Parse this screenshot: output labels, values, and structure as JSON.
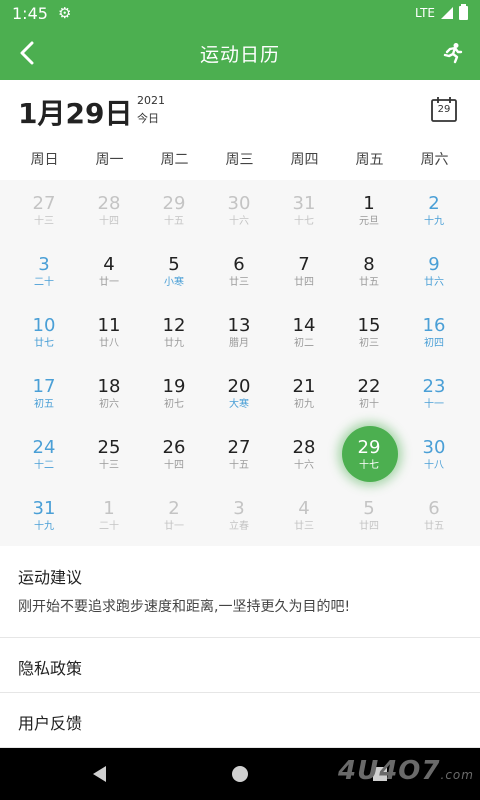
{
  "status_bar": {
    "time": "1:45",
    "network": "LTE"
  },
  "app_bar": {
    "title": "运动日历"
  },
  "date_header": {
    "date": "1月29日",
    "year": "2021",
    "today": "今日",
    "calendar_button_day": "29"
  },
  "weekdays": [
    "周日",
    "周一",
    "周二",
    "周三",
    "周四",
    "周五",
    "周六"
  ],
  "calendar": [
    [
      {
        "d": "27",
        "l": "十三",
        "t": "other"
      },
      {
        "d": "28",
        "l": "十四",
        "t": "other"
      },
      {
        "d": "29",
        "l": "十五",
        "t": "other"
      },
      {
        "d": "30",
        "l": "十六",
        "t": "other"
      },
      {
        "d": "31",
        "l": "十七",
        "t": "other"
      },
      {
        "d": "1",
        "l": "元旦",
        "t": "normal"
      },
      {
        "d": "2",
        "l": "十九",
        "t": "weekend"
      }
    ],
    [
      {
        "d": "3",
        "l": "二十",
        "t": "weekend"
      },
      {
        "d": "4",
        "l": "廿一",
        "t": "normal"
      },
      {
        "d": "5",
        "l": "小寒",
        "t": "normal",
        "term": true
      },
      {
        "d": "6",
        "l": "廿三",
        "t": "normal"
      },
      {
        "d": "7",
        "l": "廿四",
        "t": "normal"
      },
      {
        "d": "8",
        "l": "廿五",
        "t": "normal"
      },
      {
        "d": "9",
        "l": "廿六",
        "t": "weekend"
      }
    ],
    [
      {
        "d": "10",
        "l": "廿七",
        "t": "weekend"
      },
      {
        "d": "11",
        "l": "廿八",
        "t": "normal"
      },
      {
        "d": "12",
        "l": "廿九",
        "t": "normal"
      },
      {
        "d": "13",
        "l": "腊月",
        "t": "normal"
      },
      {
        "d": "14",
        "l": "初二",
        "t": "normal"
      },
      {
        "d": "15",
        "l": "初三",
        "t": "normal"
      },
      {
        "d": "16",
        "l": "初四",
        "t": "weekend"
      }
    ],
    [
      {
        "d": "17",
        "l": "初五",
        "t": "weekend"
      },
      {
        "d": "18",
        "l": "初六",
        "t": "normal"
      },
      {
        "d": "19",
        "l": "初七",
        "t": "normal"
      },
      {
        "d": "20",
        "l": "大寒",
        "t": "normal",
        "term": true
      },
      {
        "d": "21",
        "l": "初九",
        "t": "normal"
      },
      {
        "d": "22",
        "l": "初十",
        "t": "normal"
      },
      {
        "d": "23",
        "l": "十一",
        "t": "weekend"
      }
    ],
    [
      {
        "d": "24",
        "l": "十二",
        "t": "weekend"
      },
      {
        "d": "25",
        "l": "十三",
        "t": "normal"
      },
      {
        "d": "26",
        "l": "十四",
        "t": "normal"
      },
      {
        "d": "27",
        "l": "十五",
        "t": "normal"
      },
      {
        "d": "28",
        "l": "十六",
        "t": "normal"
      },
      {
        "d": "29",
        "l": "十七",
        "t": "selected"
      },
      {
        "d": "30",
        "l": "十八",
        "t": "weekend"
      }
    ],
    [
      {
        "d": "31",
        "l": "十九",
        "t": "weekend"
      },
      {
        "d": "1",
        "l": "二十",
        "t": "other"
      },
      {
        "d": "2",
        "l": "廿一",
        "t": "other"
      },
      {
        "d": "3",
        "l": "立春",
        "t": "other"
      },
      {
        "d": "4",
        "l": "廿三",
        "t": "other"
      },
      {
        "d": "5",
        "l": "廿四",
        "t": "other"
      },
      {
        "d": "6",
        "l": "廿五",
        "t": "other"
      }
    ]
  ],
  "advice": {
    "title": "运动建议",
    "text": "刚开始不要追求跑步速度和距离,一坚持更久为目的吧!"
  },
  "menu": {
    "privacy": "隐私政策",
    "feedback": "用户反馈"
  },
  "watermark": {
    "text": "4U4O7",
    "suffix": ".com"
  },
  "colors": {
    "accent": "#4caf50",
    "weekend": "#4a9fd6"
  }
}
